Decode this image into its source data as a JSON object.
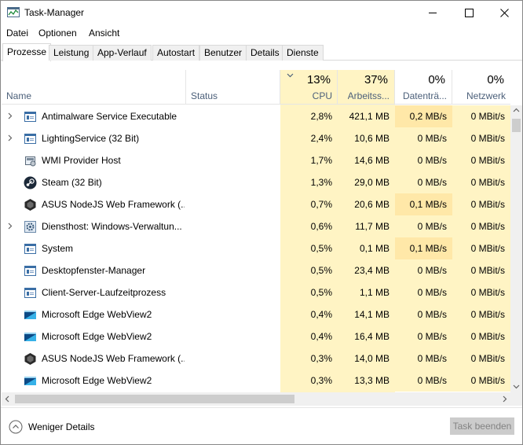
{
  "window": {
    "title": "Task-Manager"
  },
  "menu": [
    "Datei",
    "Optionen",
    "Ansicht"
  ],
  "tabs": [
    "Prozesse",
    "Leistung",
    "App-Verlauf",
    "Autostart",
    "Benutzer",
    "Details",
    "Dienste"
  ],
  "active_tab": "Prozesse",
  "columns": {
    "name": "Name",
    "status": "Status",
    "cpu": {
      "pct": "13%",
      "label": "CPU"
    },
    "memory": {
      "pct": "37%",
      "label": "Arbeitss..."
    },
    "disk": {
      "pct": "0%",
      "label": "Datenträ..."
    },
    "network": {
      "pct": "0%",
      "label": "Netzwerk"
    }
  },
  "colors": {
    "heat_light": "#fff4c4",
    "heat_mid": "#ffe8a8",
    "header_text": "#4c607a"
  },
  "processes": [
    {
      "name": "Antimalware Service Executable",
      "expandable": true,
      "icon": "window-icon",
      "cpu": "2,8%",
      "memory": "421,1 MB",
      "disk": "0,2 MB/s",
      "network": "0 MBit/s"
    },
    {
      "name": "LightingService (32 Bit)",
      "expandable": true,
      "icon": "window-icon",
      "cpu": "2,4%",
      "memory": "10,6 MB",
      "disk": "0 MB/s",
      "network": "0 MBit/s"
    },
    {
      "name": "WMI Provider Host",
      "expandable": false,
      "icon": "wmi-icon",
      "cpu": "1,7%",
      "memory": "14,6 MB",
      "disk": "0 MB/s",
      "network": "0 MBit/s"
    },
    {
      "name": "Steam (32 Bit)",
      "expandable": false,
      "icon": "steam-icon",
      "cpu": "1,3%",
      "memory": "29,0 MB",
      "disk": "0 MB/s",
      "network": "0 MBit/s"
    },
    {
      "name": "ASUS NodeJS Web Framework (...",
      "expandable": false,
      "icon": "asus-icon",
      "cpu": "0,7%",
      "memory": "20,6 MB",
      "disk": "0,1 MB/s",
      "network": "0 MBit/s"
    },
    {
      "name": "Diensthost: Windows-Verwaltun...",
      "expandable": true,
      "icon": "gear-icon",
      "cpu": "0,6%",
      "memory": "11,7 MB",
      "disk": "0 MB/s",
      "network": "0 MBit/s"
    },
    {
      "name": "System",
      "expandable": false,
      "icon": "window-icon",
      "cpu": "0,5%",
      "memory": "0,1 MB",
      "disk": "0,1 MB/s",
      "network": "0 MBit/s"
    },
    {
      "name": "Desktopfenster-Manager",
      "expandable": false,
      "icon": "window-icon",
      "cpu": "0,5%",
      "memory": "23,4 MB",
      "disk": "0 MB/s",
      "network": "0 MBit/s"
    },
    {
      "name": "Client-Server-Laufzeitprozess",
      "expandable": false,
      "icon": "window-icon",
      "cpu": "0,5%",
      "memory": "1,1 MB",
      "disk": "0 MB/s",
      "network": "0 MBit/s"
    },
    {
      "name": "Microsoft Edge WebView2",
      "expandable": false,
      "icon": "edge-webview-icon",
      "cpu": "0,4%",
      "memory": "14,1 MB",
      "disk": "0 MB/s",
      "network": "0 MBit/s"
    },
    {
      "name": "Microsoft Edge WebView2",
      "expandable": false,
      "icon": "edge-webview-icon",
      "cpu": "0,4%",
      "memory": "16,4 MB",
      "disk": "0 MB/s",
      "network": "0 MBit/s"
    },
    {
      "name": "ASUS NodeJS Web Framework (...",
      "expandable": false,
      "icon": "asus-icon",
      "cpu": "0,3%",
      "memory": "14,0 MB",
      "disk": "0 MB/s",
      "network": "0 MBit/s"
    },
    {
      "name": "Microsoft Edge WebView2",
      "expandable": false,
      "icon": "edge-webview-icon",
      "cpu": "0,3%",
      "memory": "13,3 MB",
      "disk": "0 MB/s",
      "network": "0 MBit/s"
    }
  ],
  "footer": {
    "less_details": "Weniger Details",
    "end_task": "Task beenden"
  }
}
